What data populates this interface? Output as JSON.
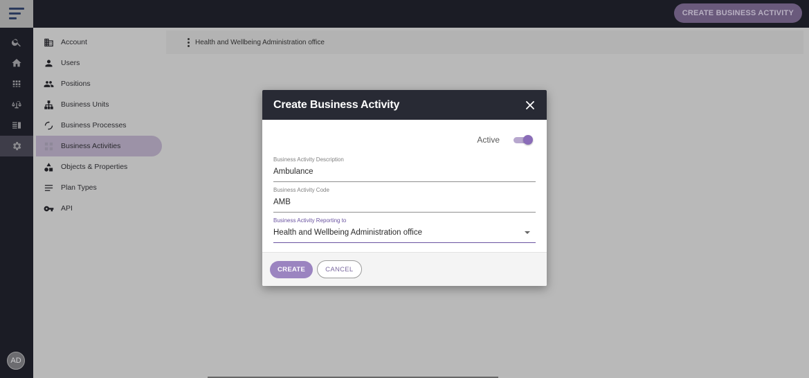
{
  "topbar": {
    "create_button": "CREATE BUSINESS ACTIVITY"
  },
  "rail": {
    "items": [
      {
        "icon": "search-icon"
      },
      {
        "icon": "home-icon"
      },
      {
        "icon": "grid-icon"
      },
      {
        "icon": "scales-icon"
      },
      {
        "icon": "list-icon"
      },
      {
        "icon": "gear-icon",
        "active": true
      }
    ],
    "avatar": "AD"
  },
  "sidebar": {
    "items": [
      {
        "label": "Account",
        "icon": "building-icon"
      },
      {
        "label": "Users",
        "icon": "user-icon"
      },
      {
        "label": "Positions",
        "icon": "group-icon"
      },
      {
        "label": "Business Units",
        "icon": "hierarchy-icon"
      },
      {
        "label": "Business Processes",
        "icon": "cycle-icon"
      },
      {
        "label": "Business Activities",
        "icon": "activity-grid-icon",
        "active": true
      },
      {
        "label": "Objects & Properties",
        "icon": "shapes-icon"
      },
      {
        "label": "Plan Types",
        "icon": "lines-icon"
      },
      {
        "label": "API",
        "icon": "key-icon"
      }
    ]
  },
  "breadcrumb": {
    "text": "Health and Wellbeing Administration office"
  },
  "modal": {
    "title": "Create Business Activity",
    "active_label": "Active",
    "fields": {
      "description": {
        "label": "Business Activity Description",
        "value": "Ambulance"
      },
      "code": {
        "label": "Business Activity Code",
        "value": "AMB"
      },
      "reporting": {
        "label": "Business Activity Reporting to",
        "value": "Health and Wellbeing Administration office"
      }
    },
    "create_label": "CREATE",
    "cancel_label": "CANCEL"
  },
  "colors": {
    "accent": "#8a6cb8",
    "dark_bg": "#1b1c25",
    "modal_header": "#282a34"
  }
}
